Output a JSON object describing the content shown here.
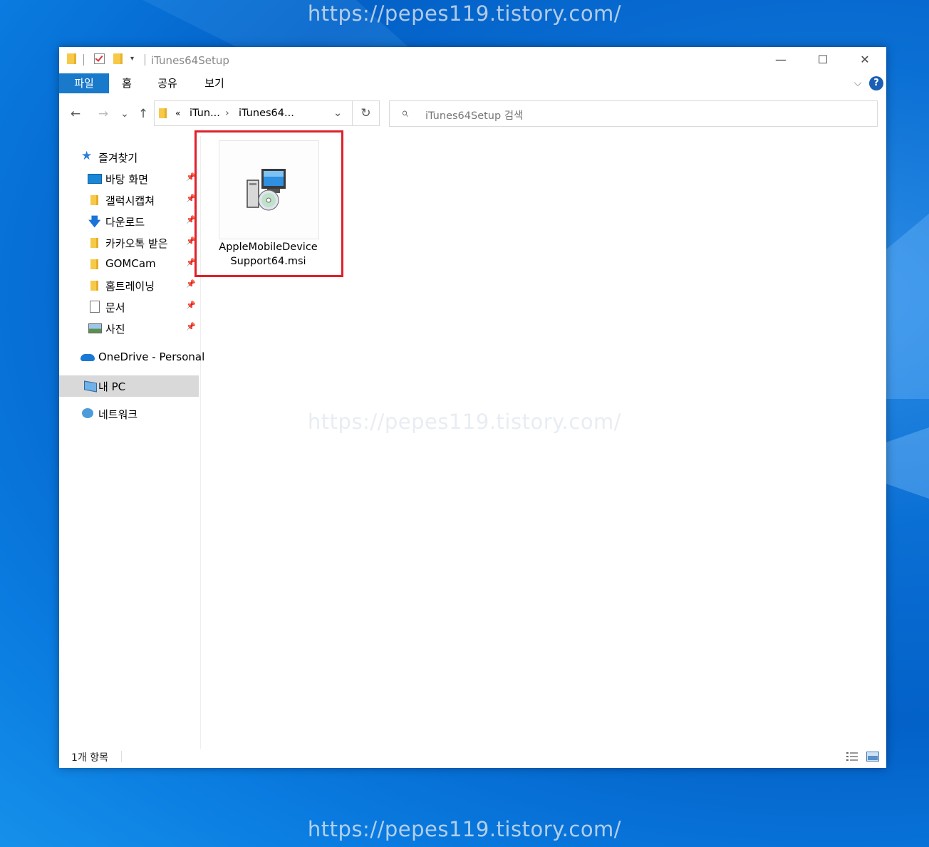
{
  "watermark": "https://pepes119.tistory.com/",
  "window": {
    "title": "iTunes64Setup",
    "controls": {
      "minimize": "—",
      "maximize": "☐",
      "close": "✕"
    }
  },
  "ribbon": {
    "tabs": [
      "파일",
      "홈",
      "공유",
      "보기"
    ],
    "expand_icon": "chevron-down-icon",
    "help": "?"
  },
  "address": {
    "back": "←",
    "forward": "→",
    "recent": "⌄",
    "up": "↑",
    "overflow": "«",
    "crumbs": [
      "iTun...",
      "iTunes64..."
    ],
    "separator": "›",
    "dropdown": "⌄",
    "refresh": "↻"
  },
  "search": {
    "placeholder": "iTunes64Setup 검색",
    "icon": "⌕"
  },
  "sidebar": {
    "quick_access": {
      "label": "즐겨찾기",
      "items": [
        {
          "label": "바탕 화면",
          "icon": "desktop-icon",
          "pinned": true
        },
        {
          "label": "갤럭시캡쳐",
          "icon": "folder-icon",
          "pinned": true
        },
        {
          "label": "다운로드",
          "icon": "download-icon",
          "pinned": true
        },
        {
          "label": "카카오톡 받은 ",
          "icon": "folder-icon",
          "pinned": true
        },
        {
          "label": "GOMCam",
          "icon": "folder-icon",
          "pinned": true
        },
        {
          "label": "홈트레이닝",
          "icon": "folder-icon",
          "pinned": true
        },
        {
          "label": "문서",
          "icon": "document-icon",
          "pinned": true
        },
        {
          "label": "사진",
          "icon": "picture-icon",
          "pinned": true
        }
      ]
    },
    "onedrive": "OneDrive - Personal",
    "this_pc": "내 PC",
    "network": "네트워크"
  },
  "files": [
    {
      "name_line1": "AppleMobileDevice",
      "name_line2": "Support64.msi",
      "icon": "msi-installer-icon",
      "highlighted": true
    }
  ],
  "statusbar": {
    "count": "1개 항목"
  },
  "colors": {
    "accent": "#1979ca",
    "highlight": "#e0202a",
    "selected": "#d9d9d9"
  }
}
